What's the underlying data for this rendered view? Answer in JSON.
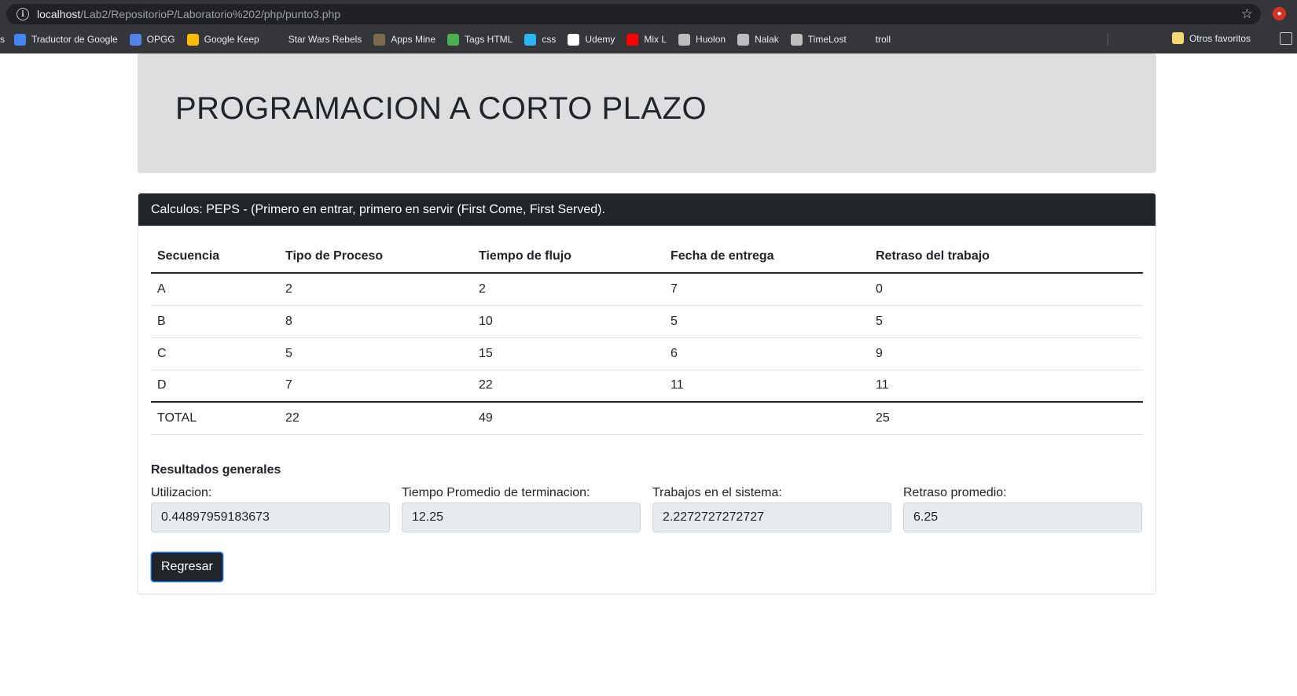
{
  "browser": {
    "url_host": "localhost",
    "url_path": "/Lab2/RepositorioP/Laboratorio%202/php/punto3.php",
    "bookmarks_truncated": "s",
    "bookmarks": [
      {
        "label": "Traductor de Google",
        "icon": "google-translate-icon",
        "color": "#4285f4"
      },
      {
        "label": "OPGG",
        "icon": "opgg-icon",
        "color": "#5383e8"
      },
      {
        "label": "Google Keep",
        "icon": "keep-icon",
        "color": "#fbbc04"
      },
      {
        "label": "Star Wars Rebels",
        "icon": "rebels-icon",
        "color": "#35363a"
      },
      {
        "label": "Apps Mine",
        "icon": "apps-icon",
        "color": "#7a6a4f"
      },
      {
        "label": "Tags HTML",
        "icon": "tags-icon",
        "color": "#4caf50"
      },
      {
        "label": "css",
        "icon": "css-icon",
        "color": "#29b6f6"
      },
      {
        "label": "Udemy",
        "icon": "udemy-icon",
        "color": "#ffffff"
      },
      {
        "label": "Mix L",
        "icon": "youtube-icon",
        "color": "#ff0000"
      },
      {
        "label": "Huolon",
        "icon": "cat-icon",
        "color": "#bdbdbd"
      },
      {
        "label": "Nalak",
        "icon": "cat-icon",
        "color": "#bdbdbd"
      },
      {
        "label": "TimeLost",
        "icon": "cat-icon",
        "color": "#bdbdbd"
      },
      {
        "label": "troll",
        "icon": "bbc-icon",
        "color": "#35363a"
      }
    ],
    "other_bookmarks": "Otros favoritos"
  },
  "page": {
    "title": "PROGRAMACION A CORTO PLAZO",
    "card_header": "Calculos: PEPS - (Primero en entrar, primero en servir (First Come, First Served).",
    "table": {
      "headers": [
        "Secuencia",
        "Tipo de Proceso",
        "Tiempo de flujo",
        "Fecha de entrega",
        "Retraso del trabajo"
      ],
      "rows": [
        [
          "A",
          "2",
          "2",
          "7",
          "0"
        ],
        [
          "B",
          "8",
          "10",
          "5",
          "5"
        ],
        [
          "C",
          "5",
          "15",
          "6",
          "9"
        ],
        [
          "D",
          "7",
          "22",
          "11",
          "11"
        ]
      ],
      "total": [
        "TOTAL",
        "22",
        "49",
        "",
        "25"
      ]
    },
    "results": {
      "title": "Resultados generales",
      "fields": [
        {
          "label": "Utilizacion:",
          "value": "0.44897959183673"
        },
        {
          "label": "Tiempo Promedio de terminacion:",
          "value": "12.25"
        },
        {
          "label": "Trabajos en el sistema:",
          "value": "2.2272727272727"
        },
        {
          "label": "Retraso promedio:",
          "value": "6.25"
        }
      ]
    },
    "back_button": "Regresar"
  }
}
